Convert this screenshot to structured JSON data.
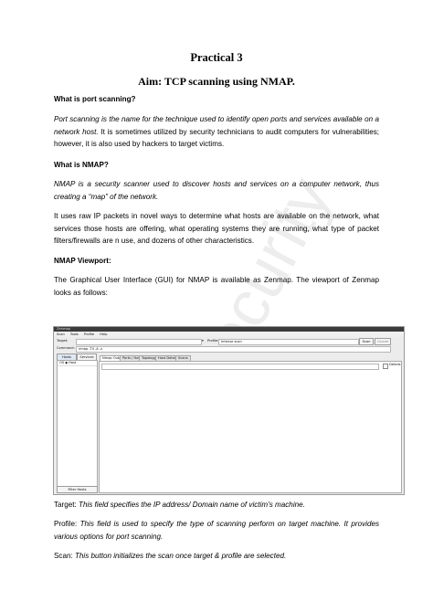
{
  "title": "Practical 3",
  "aim": "Aim: TCP scanning using NMAP.",
  "sections": {
    "port_heading": "What is port scanning?",
    "port_italic": "Port scanning is the name for the technique used to identify open ports and services available on a network host.",
    "port_rest": " It is sometimes utilized by security technicians to audit computers for vulnerabilities; however, it is also used by hackers to target victims.",
    "nmap_heading": "What is NMAP?",
    "nmap_italic": "NMAP is a security scanner used to discover hosts and services on a computer network, thus creating a “map” of the network.",
    "nmap_para": "It uses raw IP packets in novel ways to determine what hosts are available on the network, what services those hosts are offering, what operating systems they are running, what type of packet filters/firewalls are n use, and dozens of other characteristics.",
    "viewport_heading": "NMAP Viewport:",
    "viewport_para": "The Graphical User Interface (GUI) for NMAP is available as Zenmap. The viewport of Zenmap looks as follows:"
  },
  "watermark": "security",
  "zenmap": {
    "window_title": "Zenmap",
    "menu": [
      "Scan",
      "Tools",
      "Profile",
      "Help"
    ],
    "target_label": "Target:",
    "profile_label": "Profile:",
    "profile_value": "Intense scan",
    "scan_button": "Scan",
    "cancel_button": "Cancel",
    "command_label": "Command:",
    "command_value": "nmap -T4 -A -v",
    "hosts_tab": "Hosts",
    "services_tab": "Services",
    "list_header": "OS ◆ Host",
    "tabs": [
      "Nmap Output",
      "Ports / Hosts",
      "Topology",
      "Host Details",
      "Scans"
    ],
    "details_button": "Details",
    "filter_button": "Filter Hosts"
  },
  "captions": {
    "target_label": "Target: ",
    "target_text": "This field specifies the IP address/ Domain name of victim’s machine.",
    "profile_label": "Profile: ",
    "profile_text": "This field is used to specify the type of scanning perform on target machine. It provides various options for port scanning.",
    "scan_label": "Scan: ",
    "scan_text": "This button initializes the scan once target & profile are selected."
  }
}
